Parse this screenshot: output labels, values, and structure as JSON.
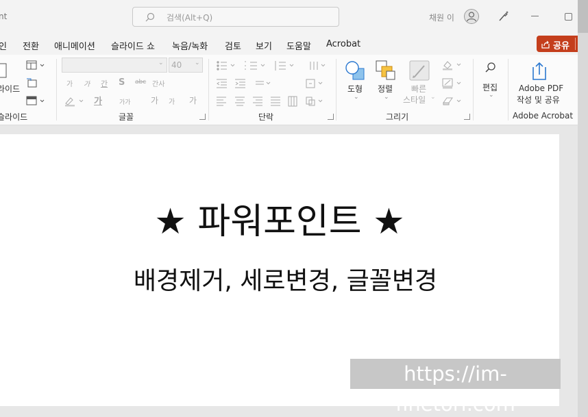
{
  "titlebar": {
    "app_name_fragment": "nt",
    "search_placeholder": "검색(Alt+Q)",
    "user_name": "채원 이"
  },
  "menu": {
    "tabs": [
      "인",
      "전환",
      "애니메이션",
      "슬라이드 쇼",
      "녹음/녹화",
      "검토",
      "보기",
      "도움말",
      "Acrobat"
    ],
    "share_label": "공유"
  },
  "ribbon": {
    "slide_group": {
      "new_slide_label": "라이드",
      "group_label": "슬라이드"
    },
    "font_group": {
      "font_size": "40",
      "group_label": "글꼴",
      "char_label": "가",
      "char_small": "가",
      "char_size": "가가",
      "char_spacing": "간",
      "char_bold": "S",
      "char_strike": "abc",
      "char_case": "간사",
      "char_grow": "가",
      "char_shrink": "가",
      "char_clear": "가"
    },
    "paragraph_group": {
      "group_label": "단락"
    },
    "drawing_group": {
      "shapes_label": "도형",
      "arrange_label": "정렬",
      "quick_styles_label": "빠른\n스타일",
      "quick_styles_line1": "빠른",
      "quick_styles_line2": "스타일",
      "group_label": "그리기"
    },
    "editing_group": {
      "edit_label": "편집"
    },
    "adobe_group": {
      "create_pdf_line1": "Adobe PDF",
      "create_pdf_line2": "작성 및 공유",
      "group_label": "Adobe Acrobat"
    }
  },
  "slide": {
    "title": "★ 파워포인트 ★",
    "subtitle": "배경제거, 세로변경, 글꼴변경",
    "watermark": "https://im-finetori.com"
  },
  "colors": {
    "accent_share": "#c43e1c",
    "ribbon_bg": "#fbfbfb",
    "window_bg": "#f3f3f3"
  },
  "icons": [
    "search-icon",
    "avatar-icon",
    "designer-icon",
    "minimize-icon",
    "maximize-icon",
    "share-icon",
    "chevron-down-icon",
    "shapes-icon",
    "arrange-icon",
    "quick-styles-icon",
    "find-icon",
    "adobe-pdf-icon"
  ]
}
